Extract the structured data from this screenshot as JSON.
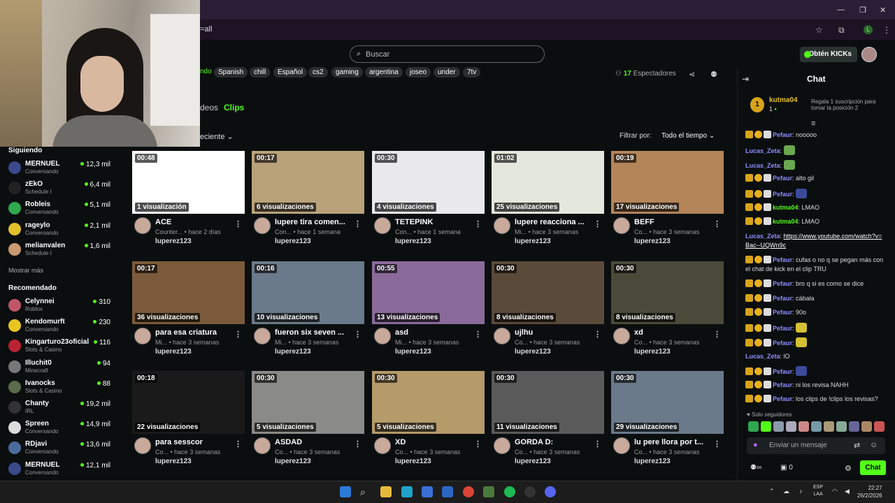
{
  "browser": {
    "url_fragment": "=all",
    "window_controls": [
      "—",
      "❐",
      "✕"
    ],
    "profile_initial": "L"
  },
  "header": {
    "search_placeholder": "Buscar",
    "kick_button_label": "Obtén KICKs",
    "tags_partial": "ndo",
    "tags": [
      "Spanish",
      "chill",
      "Español",
      "cs2",
      "gaming",
      "argentina",
      "joseo",
      "under",
      "7tv"
    ],
    "viewers_count": "17",
    "viewers_label": "Espectadores"
  },
  "tabs": {
    "videos_partial": "deos",
    "clips": "Clips"
  },
  "sort": {
    "selected_partial": "eciente",
    "filter_label": "Filtrar por:",
    "filter_value": "Todo el tiempo"
  },
  "sidebar": {
    "following_heading": "Siguiendo",
    "following": [
      {
        "name": "MERNUEL",
        "category": "Conversando",
        "viewers": "12,3 mil",
        "color": "#3a4a8a"
      },
      {
        "name": "zEkO",
        "category": "Schedule I",
        "viewers": "6,4 mil",
        "color": "#222"
      },
      {
        "name": "Robleis",
        "category": "Conversando",
        "viewers": "5,1 mil",
        "color": "#2fa84f"
      },
      {
        "name": "rageylo",
        "category": "Conversando",
        "viewers": "2,1 mil",
        "color": "#e2c02b"
      },
      {
        "name": "melianvalen",
        "category": "Schedule I",
        "viewers": "1,6 mil",
        "color": "#c99a70"
      }
    ],
    "show_more": "Mostrar más",
    "recommended_heading": "Recomendado",
    "recommended": [
      {
        "name": "Celynnei",
        "category": "Roblox",
        "viewers": "310",
        "color": "#c0566a"
      },
      {
        "name": "Kendomurft",
        "category": "Conversando",
        "viewers": "230",
        "color": "#e8c521"
      },
      {
        "name": "Kingarturo23oficial",
        "category": "Slots & Casino",
        "viewers": "116",
        "color": "#b23"
      },
      {
        "name": "Illuchit0",
        "category": "Minecraft",
        "viewers": "94",
        "color": "#777"
      },
      {
        "name": "Ivanocks",
        "category": "Slots & Casino",
        "viewers": "88",
        "color": "#5a6b4a"
      },
      {
        "name": "Chanty",
        "category": "IRL",
        "viewers": "19,2 mil",
        "color": "#333"
      },
      {
        "name": "Spreen",
        "category": "Conversando",
        "viewers": "14,9 mil",
        "color": "#ddd"
      },
      {
        "name": "RDjavi",
        "category": "Conversando",
        "viewers": "13,6 mil",
        "color": "#4a6a9a"
      },
      {
        "name": "MERNUEL",
        "category": "Conversando",
        "viewers": "12,1 mil",
        "color": "#3a4a8a"
      }
    ]
  },
  "clips": [
    {
      "duration": "00:48",
      "views": "1 visualización",
      "title": "ACE",
      "sub": "Counter...",
      "age": "hace 2 días",
      "author": "luperez123",
      "thumb": "#ffffff"
    },
    {
      "duration": "00:17",
      "views": "6 visualizaciones",
      "title": "lupere tira comen...",
      "sub": "Con...",
      "age": "hace 1 semana",
      "author": "luperez123",
      "thumb": "#b9a27a"
    },
    {
      "duration": "00:30",
      "views": "4 visualizaciones",
      "title": "TETEPINK",
      "sub": "Con...",
      "age": "hace 1 semana",
      "author": "luperez123",
      "thumb": "#e9e9ec"
    },
    {
      "duration": "01:02",
      "views": "25 visualizaciones",
      "title": "lupere reacciona ...",
      "sub": "Mi...",
      "age": "hace 3 semanas",
      "author": "luperez123",
      "thumb": "#e4e7dc"
    },
    {
      "duration": "00:19",
      "views": "17 visualizaciones",
      "title": "BEFF",
      "sub": "Co...",
      "age": "hace 3 semanas",
      "author": "luperez123",
      "thumb": "#b5855a"
    },
    {
      "duration": "00:17",
      "views": "36 visualizaciones",
      "title": "para esa criatura",
      "sub": "Mi...",
      "age": "hace 3 semanas",
      "author": "luperez123",
      "thumb": "#7a5a3a"
    },
    {
      "duration": "00:16",
      "views": "10 visualizaciones",
      "title": "fueron six seven ...",
      "sub": "Mi...",
      "age": "hace 3 semanas",
      "author": "luperez123",
      "thumb": "#6b7a8a"
    },
    {
      "duration": "00:55",
      "views": "13 visualizaciones",
      "title": "asd",
      "sub": "Mi...",
      "age": "hace 3 semanas",
      "author": "luperez123",
      "thumb": "#8a6a9a"
    },
    {
      "duration": "00:30",
      "views": "8 visualizaciones",
      "title": "ujlhu",
      "sub": "Co...",
      "age": "hace 3 semanas",
      "author": "luperez123",
      "thumb": "#5a4a3a"
    },
    {
      "duration": "00:30",
      "views": "8 visualizaciones",
      "title": "xd",
      "sub": "Co...",
      "age": "hace 3 semanas",
      "author": "luperez123",
      "thumb": "#4a4a3a"
    },
    {
      "duration": "00:18",
      "views": "22 visualizaciones",
      "title": "para sesscor",
      "sub": "Co...",
      "age": "hace 3 semanas",
      "author": "luperez123",
      "thumb": "#1a1a1a"
    },
    {
      "duration": "00:30",
      "views": "5 visualizaciones",
      "title": "ASDAD",
      "sub": "Co...",
      "age": "hace 3 semanas",
      "author": "luperez123",
      "thumb": "#8a8a88"
    },
    {
      "duration": "00:30",
      "views": "5 visualizaciones",
      "title": "XD",
      "sub": "Co...",
      "age": "hace 3 semanas",
      "author": "luperez123",
      "thumb": "#b59a6a"
    },
    {
      "duration": "00:30",
      "views": "11 visualizaciones",
      "title": "GORDA D:",
      "sub": "Co...",
      "age": "hace 3 semanas",
      "author": "luperez123",
      "thumb": "#5a5a5a"
    },
    {
      "duration": "00:30",
      "views": "29 visualizaciones",
      "title": "lu pere llora por t...",
      "sub": "Co...",
      "age": "hace 3 semanas",
      "author": "luperez123",
      "thumb": "#6a7a8a"
    }
  ],
  "chat": {
    "title": "Chat",
    "pinned": {
      "rank": "1",
      "name": "kutma04",
      "count": "1",
      "gift_text": "Regala 1 suscripción para tomar la posición 2"
    },
    "messages": [
      {
        "user": "Pefaur",
        "text": "nooooo",
        "user_color": "#8d8dff",
        "badges": true
      },
      {
        "user": "Lucas_Zeta",
        "text": "",
        "user_color": "#8d8dff",
        "badges": false,
        "emote": "#6aa84f"
      },
      {
        "user": "Lucas_Zeta",
        "text": "",
        "user_color": "#8d8dff",
        "badges": false,
        "emote": "#6aa84f"
      },
      {
        "user": "Pefaur",
        "text": "alto gil",
        "user_color": "#8d8dff",
        "badges": true
      },
      {
        "user": "Pefaur",
        "text": "",
        "user_color": "#8d8dff",
        "badges": true,
        "emote": "#3a4a9a"
      },
      {
        "user": "kutma04",
        "text": "LMAO",
        "user_color": "#53fc18",
        "badges": true
      },
      {
        "user": "kutma04",
        "text": "LMAO",
        "user_color": "#53fc18",
        "badges": true
      },
      {
        "user": "Lucas_Zeta",
        "text": "https://www.youtube.com/watch?v=Bac--UQWn9c",
        "user_color": "#8d8dff",
        "badges": false,
        "link": true
      },
      {
        "user": "Pefaur",
        "text": "cufas o no q se pegan más con el chat de kick en el clip TRU",
        "user_color": "#8d8dff",
        "badges": true
      },
      {
        "user": "Pefaur",
        "text": "bro q si es como se dice",
        "user_color": "#8d8dff",
        "badges": true
      },
      {
        "user": "Pefaur",
        "text": "cábala",
        "user_color": "#8d8dff",
        "badges": true
      },
      {
        "user": "Pefaur",
        "text": "90o",
        "user_color": "#8d8dff",
        "badges": true
      },
      {
        "user": "Pefaur",
        "text": "",
        "user_color": "#8d8dff",
        "badges": true,
        "emote": "#d4c032"
      },
      {
        "user": "Pefaur",
        "text": "",
        "user_color": "#8d8dff",
        "badges": true,
        "emote": "#d4c032"
      },
      {
        "user": "Lucas_Zeta",
        "text": "lO",
        "user_color": "#8d8dff",
        "badges": false
      },
      {
        "user": "Pefaur",
        "text": "",
        "user_color": "#8d8dff",
        "badges": true,
        "emote": "#3a4a9a"
      },
      {
        "user": "Pefaur",
        "text": "ni los revisa NAHH",
        "user_color": "#8d8dff",
        "badges": true
      },
      {
        "user": "Pefaur",
        "text": "los clips de !clips los revisas?",
        "user_color": "#8d8dff",
        "badges": true
      }
    ],
    "followers_only": "Solo seguidores",
    "input_placeholder": "Enviar un mensaje",
    "bar_count": "0",
    "send_label": "Chat"
  },
  "taskbar": {
    "lang_top": "ESP",
    "lang_bottom": "LAA",
    "time": "22:27",
    "date": "26/2/2026"
  },
  "colors": {
    "accent": "#53fc18",
    "background": "#0b0e0f"
  }
}
